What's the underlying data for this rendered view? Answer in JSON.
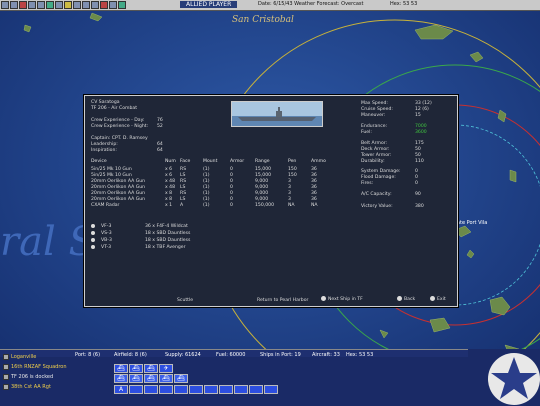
{
  "top_bar": {
    "player": "ALLIED PLAYER",
    "date_weather": "Date: 6/15/43   Weather Forecast: Overcast",
    "hex": "Hex: 53 53"
  },
  "map": {
    "labels": {
      "san_cristobal": "San Cristobal",
      "coral_sea": "ral Sea",
      "efate_port_vila": "Efate Port Vila"
    }
  },
  "ship_panel": {
    "ship_name": "CV Saratoga",
    "tf": "TF 206 - Air Combat",
    "crew_day_label": "Crew Experience - Day:",
    "crew_day": "76",
    "crew_night_label": "Crew Experience - Night:",
    "crew_night": "52",
    "captain": "Captain: CPT. D. Ramsey",
    "leadership_label": "Leadership:",
    "leadership": "64",
    "inspiration_label": "Inspiration:",
    "inspiration": "64",
    "stats": [
      {
        "label": "Max Speed:",
        "value": "33  (12)"
      },
      {
        "label": "Cruise Speed:",
        "value": "12  (6)"
      },
      {
        "label": "Maneuver:",
        "value": "15"
      },
      {
        "label": "Endurance:",
        "value": "7000"
      },
      {
        "label": "Fuel:",
        "value": "3600"
      },
      {
        "label": "Belt Armor:",
        "value": "175"
      },
      {
        "label": "Deck Armor:",
        "value": "50"
      },
      {
        "label": "Tower Armor:",
        "value": "50"
      },
      {
        "label": "Durability:",
        "value": "110"
      },
      {
        "label": "System Damage:",
        "value": "0"
      },
      {
        "label": "Flood Damage:",
        "value": "0"
      },
      {
        "label": "Fires:",
        "value": "0"
      },
      {
        "label": "A/C Capacity:",
        "value": "90"
      },
      {
        "label": "Victory Value:",
        "value": "380"
      }
    ],
    "device_headers": [
      "Device",
      "Num",
      "Face",
      "Mount",
      "Armor",
      "Range",
      "Pen",
      "Ammo"
    ],
    "devices": [
      [
        "5in/25 Mk 10 Gun",
        "x 6",
        "RS",
        "(1)",
        "0",
        "15,000",
        "150",
        "36"
      ],
      [
        "5in/25 Mk 10 Gun",
        "x 6",
        "LS",
        "(1)",
        "0",
        "15,000",
        "150",
        "36"
      ],
      [
        "20mm Oerlikon AA Gun",
        "x 48",
        "RS",
        "(1)",
        "0",
        "9,000",
        "3",
        "36"
      ],
      [
        "20mm Oerlikon AA Gun",
        "x 48",
        "LS",
        "(1)",
        "0",
        "9,000",
        "3",
        "36"
      ],
      [
        "20mm Oerlikon AA Gun",
        "x 8",
        "RS",
        "(1)",
        "0",
        "9,000",
        "3",
        "36"
      ],
      [
        "20mm Oerlikon AA Gun",
        "x 8",
        "LS",
        "(1)",
        "0",
        "9,000",
        "3",
        "36"
      ],
      [
        "CXAM Radar",
        "x 1",
        "A",
        "(1)",
        "0",
        "150,000",
        "NA",
        "NA"
      ]
    ],
    "squadrons": [
      {
        "name": "VF-3",
        "aircraft": "36 x F4F-4 Wildcat"
      },
      {
        "name": "VS-3",
        "aircraft": "18 x SBD Dauntless"
      },
      {
        "name": "VB-3",
        "aircraft": "18 x SBD Dauntless"
      },
      {
        "name": "VT-3",
        "aircraft": "18 x TBF Avenger"
      }
    ],
    "buttons": {
      "scuttle": "Scuttle",
      "return": "Return to Pearl Harbor",
      "next_ship": "Next Ship in TF",
      "back": "Back",
      "exit": "Exit"
    }
  },
  "bottom": {
    "units": [
      {
        "label": "Loganville"
      },
      {
        "label": "16th RNZAF Squadron"
      },
      {
        "label": "TF 206 is docked"
      },
      {
        "label": "38th Cst AA Rgt"
      }
    ],
    "port": "Port: 8 (6)",
    "airfield": "Airfield: 8 (6)",
    "supply": "Supply: 61624",
    "fuel": "Fuel: 60000",
    "ships_in_port": "Ships in Port: 19",
    "aircraft": "Aircraft: 33",
    "hex": "Hex: 53 53"
  },
  "colors": {
    "ocean": "#1b3a7a",
    "panel_bg": "#1f2637",
    "highlight_yellow": "#f2d04b",
    "green_value": "#3fc43f"
  }
}
